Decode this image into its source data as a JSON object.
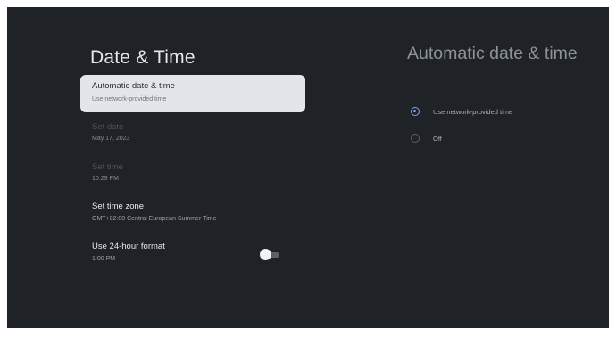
{
  "left_panel": {
    "title": "Date & Time",
    "items": [
      {
        "label": "Automatic date & time",
        "sub": "Use network-provided time"
      },
      {
        "label": "Set date",
        "sub": "May 17, 2023"
      },
      {
        "label": "Set time",
        "sub": "10:29 PM"
      },
      {
        "label": "Set time zone",
        "sub": "GMT+02:00 Central European Summer Time"
      },
      {
        "label": "Use 24-hour format",
        "sub": "1:00 PM",
        "toggle_on": false
      }
    ]
  },
  "right_panel": {
    "title": "Automatic date & time",
    "options": [
      {
        "label": "Use network-provided time",
        "selected": true
      },
      {
        "label": "Off",
        "selected": false
      }
    ]
  },
  "colors": {
    "background": "#1f2227",
    "selected_item": "#e3e5ea",
    "accent": "#7ea6f4"
  }
}
